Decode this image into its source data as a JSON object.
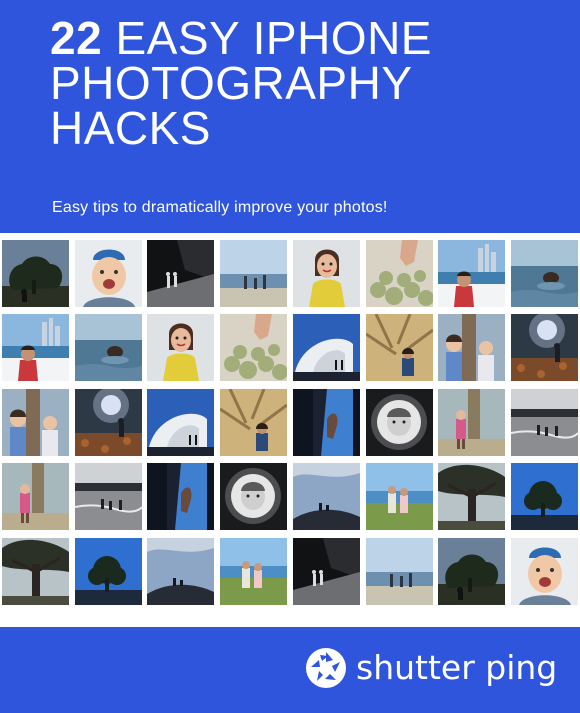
{
  "header": {
    "title_number": "22",
    "title_line1_rest": "EASY IPHONE",
    "title_line2": "PHOTOGRAPHY",
    "title_line3": "HACKS",
    "subtitle": "Easy tips to dramatically improve your photos!",
    "background_color": "#2e55dc"
  },
  "photo_grid": {
    "rows": [
      [
        "tree-silhouette",
        "laughing-boy",
        "dark-corridor",
        "beach-figures",
        "girl-yellow-dress",
        "hand-succulents",
        "beach-skyline-kids",
        "ocean-swimmer"
      ],
      [
        "beach-skyline-kids",
        "ocean-swimmer",
        "girl-yellow-dress",
        "hand-succulents",
        "white-architecture",
        "tree-shadow-girl",
        "girls-by-tree",
        "sunlit-forest"
      ],
      [
        "girls-by-tree",
        "sunlit-forest",
        "white-architecture",
        "tree-shadow-girl",
        "window-hand",
        "fisheye-child",
        "child-by-tree",
        "beach-walkers"
      ],
      [
        "child-by-tree",
        "beach-walkers",
        "window-hand",
        "fisheye-child",
        "hill-silhouette",
        "beach-dunes-girls",
        "big-tree",
        "lone-tree-sky"
      ],
      [
        "big-tree",
        "lone-tree-sky",
        "hill-silhouette",
        "beach-dunes-girls",
        "dark-corridor",
        "beach-figures",
        "tree-silhouette",
        "laughing-boy"
      ]
    ]
  },
  "footer": {
    "brand_name": "shutter ping",
    "brand_icon": "camera-aperture-icon",
    "background_color": "#2e55dc"
  }
}
